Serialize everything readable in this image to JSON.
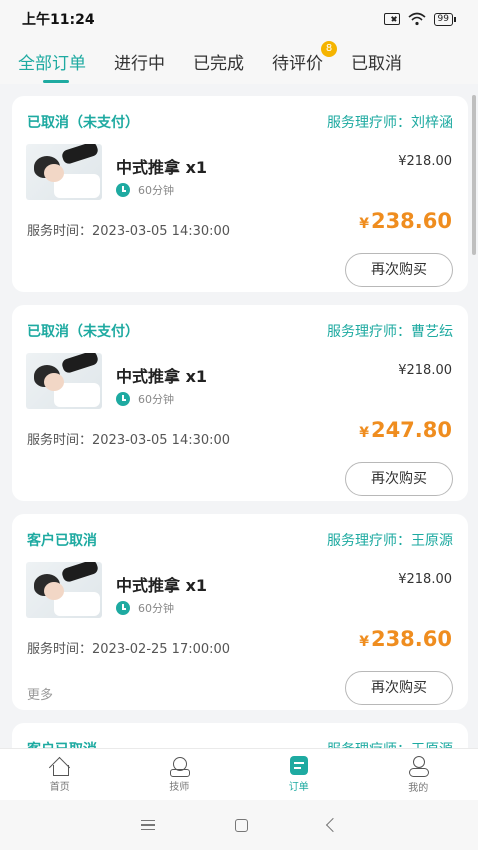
{
  "status_bar": {
    "time": "上午11:24",
    "battery": "99"
  },
  "tabs": [
    {
      "label": "全部订单",
      "active": true
    },
    {
      "label": "进行中"
    },
    {
      "label": "已完成"
    },
    {
      "label": "待评价",
      "badge": "8"
    },
    {
      "label": "已取消"
    }
  ],
  "orders": [
    {
      "status": "已取消（未支付）",
      "therapist": "服务理疗师：刘梓涵",
      "service": "中式推拿 x1",
      "duration": "60分钟",
      "unit_price": "¥218.00",
      "service_time": "服务时间：2023-03-05 14:30:00",
      "currency": "¥",
      "total": "238.60",
      "button": "再次购买"
    },
    {
      "status": "已取消（未支付）",
      "therapist": "服务理疗师：曹艺纭",
      "service": "中式推拿 x1",
      "duration": "60分钟",
      "unit_price": "¥218.00",
      "service_time": "服务时间：2023-03-05 14:30:00",
      "currency": "¥",
      "total": "247.80",
      "button": "再次购买"
    },
    {
      "status": "客户已取消",
      "therapist": "服务理疗师：王原源",
      "service": "中式推拿 x1",
      "duration": "60分钟",
      "unit_price": "¥218.00",
      "service_time": "服务时间：2023-02-25 17:00:00",
      "currency": "¥",
      "total": "238.60",
      "more": "更多",
      "button": "再次购买"
    },
    {
      "status": "客户已取消",
      "therapist": "服务理疗师：王原源"
    }
  ],
  "bottom_nav": [
    {
      "label": "首页",
      "icon": "home-icon"
    },
    {
      "label": "技师",
      "icon": "technician-icon"
    },
    {
      "label": "订单",
      "icon": "order-icon",
      "active": true
    },
    {
      "label": "我的",
      "icon": "profile-icon"
    }
  ],
  "colors": {
    "accent": "#1eaaa1",
    "price": "#ef8d1f",
    "badge": "#f5b400"
  }
}
